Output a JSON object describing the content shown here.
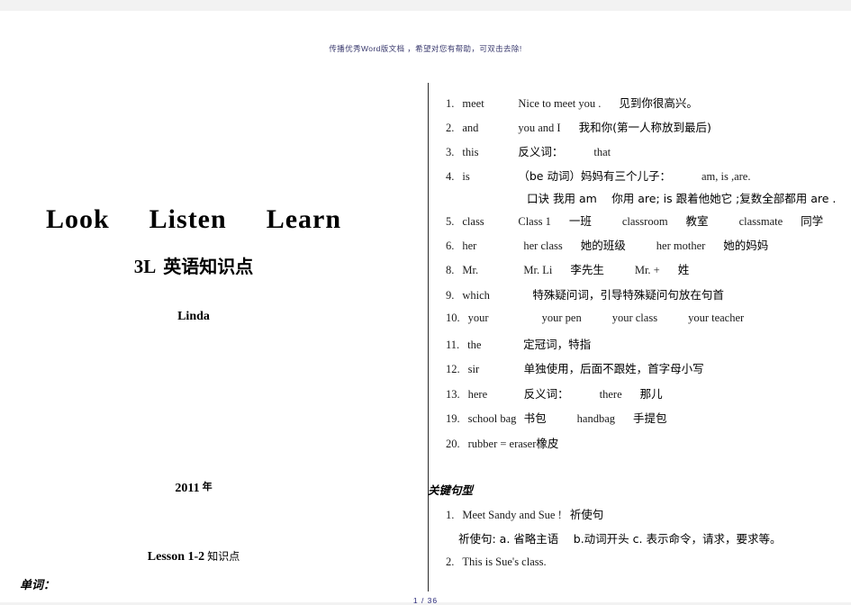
{
  "banner": {
    "text": "传播优秀Word版文档 ，希望对您有帮助，可双击去除!"
  },
  "cover": {
    "title_words": [
      "Look",
      "Listen",
      "Learn"
    ],
    "subtitle_code": "3L",
    "subtitle_cn": "英语知识点",
    "author": "Linda",
    "year_num": "2011",
    "year_cn": "年",
    "lesson_en": "Lesson  1-2",
    "lesson_cn": "知识点",
    "word_heading": "单词："
  },
  "notes": {
    "entries": [
      {
        "num": "1.",
        "word": "meet",
        "parts": [
          {
            "type": "en",
            "text": "Nice  to  meet  you ."
          },
          {
            "type": "cn",
            "text": "见到你很高兴。"
          }
        ]
      },
      {
        "num": "2.",
        "word": "and",
        "parts": [
          {
            "type": "en",
            "text": "you  and  I"
          },
          {
            "type": "cn",
            "text": "我和你(第一人称放到最后)"
          }
        ]
      },
      {
        "num": "3.",
        "word": "this",
        "parts": [
          {
            "type": "cn",
            "text": "反义词："
          },
          {
            "type": "en",
            "text": "that"
          }
        ]
      },
      {
        "num": "4.",
        "word": "is",
        "parts": [
          {
            "type": "cn",
            "text": "（be 动词）妈妈有三个儿子："
          },
          {
            "type": "en",
            "text": "am, is ,are."
          }
        ]
      },
      {
        "num": "5.",
        "word": "class",
        "parts": [
          {
            "type": "en",
            "text": "Class 1"
          },
          {
            "type": "cn",
            "text": "一班"
          },
          {
            "type": "en",
            "text": "classroom"
          },
          {
            "type": "cn",
            "text": "教室"
          },
          {
            "type": "en",
            "text": "classmate"
          },
          {
            "type": "cn",
            "text": "同学"
          }
        ]
      },
      {
        "num": "6.",
        "word": "her",
        "parts": [
          {
            "type": "en",
            "text": "her class"
          },
          {
            "type": "cn",
            "text": "她的班级"
          },
          {
            "type": "en",
            "text": "her mother"
          },
          {
            "type": "cn",
            "text": "她的妈妈"
          }
        ]
      },
      {
        "num": "8.",
        "word": "Mr.",
        "parts": [
          {
            "type": "en",
            "text": "Mr. Li"
          },
          {
            "type": "cn",
            "text": "李先生"
          },
          {
            "type": "en",
            "text": "Mr. +"
          },
          {
            "type": "cn",
            "text": "姓"
          }
        ]
      },
      {
        "num": "9.",
        "word": "which",
        "parts": [
          {
            "type": "cn",
            "text": "特殊疑问词，引导特殊疑问句放在句首"
          }
        ]
      },
      {
        "num": "10.",
        "word": "your",
        "parts": [
          {
            "type": "en",
            "text": "your pen"
          },
          {
            "type": "en",
            "text": "your class"
          },
          {
            "type": "en",
            "text": "your teacher"
          }
        ]
      },
      {
        "num": "11.",
        "word": "the",
        "parts": [
          {
            "type": "cn",
            "text": "定冠词，特指"
          }
        ]
      },
      {
        "num": "12.",
        "word": "sir",
        "parts": [
          {
            "type": "cn",
            "text": "单独使用，后面不跟姓，首字母小写"
          }
        ]
      },
      {
        "num": "13.",
        "word": "here",
        "parts": [
          {
            "type": "cn",
            "text": "反义词："
          },
          {
            "type": "en",
            "text": "there"
          },
          {
            "type": "cn",
            "text": "那儿"
          }
        ]
      },
      {
        "num": "19.",
        "word": "school  bag",
        "parts": [
          {
            "type": "cn",
            "text": "书包"
          },
          {
            "type": "en",
            "text": "handbag"
          },
          {
            "type": "cn",
            "text": "手提包"
          }
        ]
      },
      {
        "num": "20.",
        "word": "rubber  =  eraser",
        "parts": [
          {
            "type": "cn",
            "text": "橡皮"
          }
        ]
      }
    ],
    "mnemonic": "口诀 我用 am　 你用 are; is 跟着他她它 ;复数全部都用 are .",
    "key_patterns_heading": "关键句型",
    "patterns": [
      {
        "num": "1.",
        "en": "Meet  Sandy  and  Sue !",
        "cn": "祈使句"
      },
      {
        "num": "2.",
        "en": "This  is  Sue's  class.",
        "cn": ""
      }
    ],
    "pattern_note": "祈使句: a.  省略主语　 b.动词开头  c.  表示命令，请求，要求等。"
  },
  "footer": {
    "page_label": "1 / 36"
  }
}
